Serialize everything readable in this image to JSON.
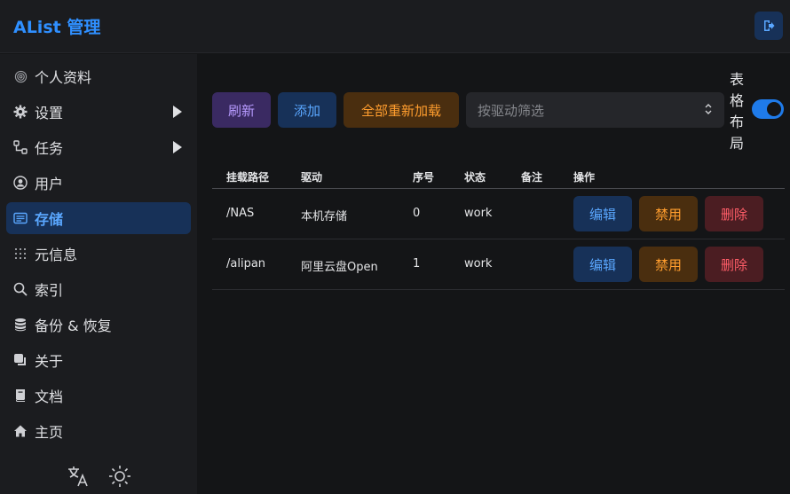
{
  "header": {
    "brand": "AList 管理"
  },
  "sidebar": {
    "items": [
      {
        "label": "个人资料",
        "icon": "fingerprint-icon",
        "active": false,
        "has_arrow": false
      },
      {
        "label": "设置",
        "icon": "gear-icon",
        "active": false,
        "has_arrow": true
      },
      {
        "label": "任务",
        "icon": "task-flow-icon",
        "active": false,
        "has_arrow": true
      },
      {
        "label": "用户",
        "icon": "user-circle-icon",
        "active": false,
        "has_arrow": false
      },
      {
        "label": "存储",
        "icon": "storage-icon",
        "active": true,
        "has_arrow": false
      },
      {
        "label": "元信息",
        "icon": "meta-icon",
        "active": false,
        "has_arrow": false
      },
      {
        "label": "索引",
        "icon": "search-icon",
        "active": false,
        "has_arrow": false
      },
      {
        "label": "备份 & 恢复",
        "icon": "database-icon",
        "active": false,
        "has_arrow": false
      },
      {
        "label": "关于",
        "icon": "copy-icon",
        "active": false,
        "has_arrow": false
      },
      {
        "label": "文档",
        "icon": "book-icon",
        "active": false,
        "has_arrow": false
      },
      {
        "label": "主页",
        "icon": "home-icon",
        "active": false,
        "has_arrow": false
      }
    ]
  },
  "toolbar": {
    "refresh": "刷新",
    "add": "添加",
    "reload_all": "全部重新加载",
    "filter_placeholder": "按驱动筛选",
    "layout_label": [
      "表",
      "格",
      "布",
      "局"
    ],
    "table_layout_enabled": true
  },
  "table": {
    "headers": [
      "挂载路径",
      "驱动",
      "序号",
      "状态",
      "备注",
      "操作"
    ],
    "rows": [
      {
        "path": "/NAS",
        "driver": "本机存储",
        "order": "0",
        "status": "work",
        "remark": ""
      },
      {
        "path": "/alipan",
        "driver": "阿里云盘Open",
        "order": "1",
        "status": "work",
        "remark": ""
      }
    ],
    "actions": {
      "edit": "编辑",
      "disable": "禁用",
      "delete": "删除"
    }
  },
  "colors": {
    "accent": "#2f8fff",
    "refresh": "#b79bff",
    "warning": "#ff9d2e",
    "danger": "#ff5d68"
  }
}
